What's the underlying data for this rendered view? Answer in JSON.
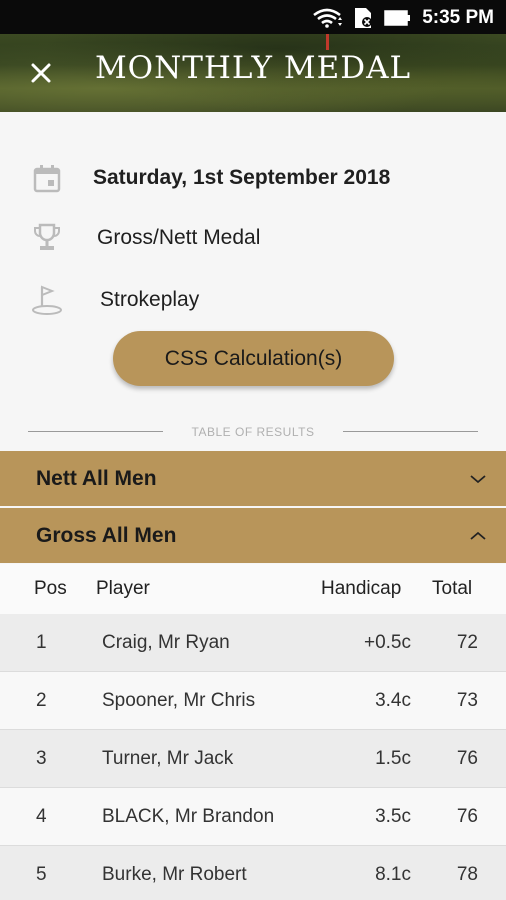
{
  "status_bar": {
    "time": "5:35 PM"
  },
  "header": {
    "title": "MONTHLY MEDAL"
  },
  "event": {
    "date": "Saturday, 1st September 2018",
    "competition": "Gross/Nett Medal",
    "format": "Strokeplay"
  },
  "css_button_label": "CSS Calculation(s)",
  "table_of_results_label": "TABLE OF RESULTS",
  "sections": [
    {
      "label": "Nett All Men",
      "expanded": false
    },
    {
      "label": "Gross All Men",
      "expanded": true
    }
  ],
  "results_table": {
    "columns": [
      "Pos",
      "Player",
      "Handicap",
      "Total"
    ],
    "rows": [
      {
        "pos": "1",
        "player": "Craig, Mr Ryan",
        "handicap": "+0.5c",
        "total": "72"
      },
      {
        "pos": "2",
        "player": "Spooner, Mr Chris",
        "handicap": "3.4c",
        "total": "73"
      },
      {
        "pos": "3",
        "player": "Turner, Mr Jack",
        "handicap": "1.5c",
        "total": "76"
      },
      {
        "pos": "4",
        "player": "BLACK, Mr Brandon",
        "handicap": "3.5c",
        "total": "76"
      },
      {
        "pos": "5",
        "player": "Burke, Mr Robert",
        "handicap": "8.1c",
        "total": "78"
      }
    ]
  },
  "colors": {
    "accent": "#b8955a",
    "status_bar": "#0a0a0a",
    "row_alt": "#ececec"
  }
}
